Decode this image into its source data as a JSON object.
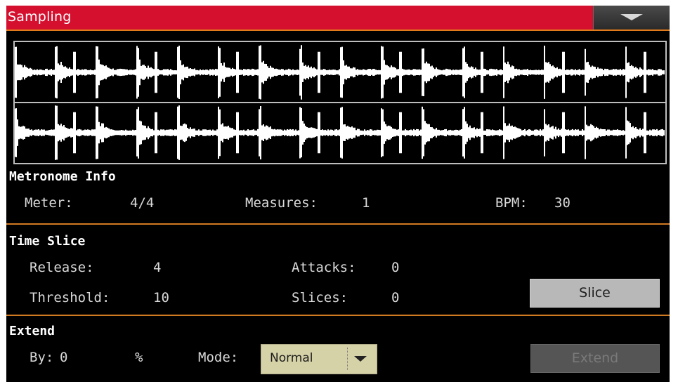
{
  "window": {
    "title": "Sampling"
  },
  "metronome": {
    "heading": "Metronome Info",
    "meter_label": "Meter:",
    "meter_value": "4/4",
    "measures_label": "Measures:",
    "measures_value": "1",
    "bpm_label": "BPM:",
    "bpm_value": "30"
  },
  "time_slice": {
    "heading": "Time Slice",
    "release_label": "Release:",
    "release_value": "4",
    "threshold_label": "Threshold:",
    "threshold_value": "10",
    "attacks_label": "Attacks:",
    "attacks_value": "0",
    "slices_label": "Slices:",
    "slices_value": "0",
    "slice_button": "Slice"
  },
  "extend": {
    "heading": "Extend",
    "by_label": "By:",
    "by_value": "0",
    "percent": "%",
    "mode_label": "Mode:",
    "mode_value": "Normal",
    "extend_button": "Extend"
  },
  "icons": {
    "menu": "chevron-down-icon",
    "dropdown": "chevron-down-icon"
  },
  "colors": {
    "title_bar": "#d4102e",
    "separator": "#d07a22",
    "background": "#000000",
    "waveform": "#ffffff",
    "select_bg": "#d6d2a8",
    "button_bg": "#b8b8b8"
  }
}
